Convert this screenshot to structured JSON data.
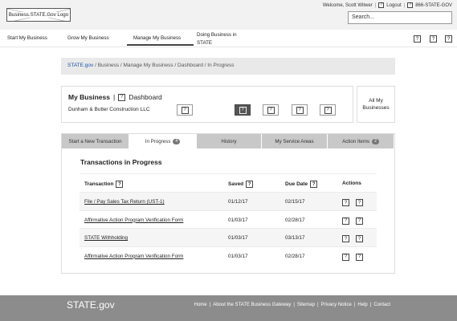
{
  "header": {
    "logo_text": "Business.STATE.Gov Logo",
    "welcome": "Welcome, Scott Witwer",
    "logout": "Logout",
    "phone": "866-STATE-GOV",
    "search_placeholder": "Search..."
  },
  "nav": {
    "items": [
      "Start My Business",
      "Grow My Business",
      "Manage My Business"
    ],
    "doing_line1": "Doing Business in",
    "doing_line2": "STATE"
  },
  "breadcrumb": {
    "home": "STATE.gov",
    "path": "/   Business  /  Manage My Business  /  Dashboard  /  In Progress"
  },
  "dashboard": {
    "title": "My Business",
    "separator": "|",
    "subtitle": "Dashboard",
    "company": "Dunham & Butler Construction LLC",
    "all_businesses_line1": "All My",
    "all_businesses_line2": "Businesses"
  },
  "tabs": [
    {
      "label": "Start a New Transaction",
      "badge": ""
    },
    {
      "label": "In Progress",
      "badge": "4"
    },
    {
      "label": "History",
      "badge": ""
    },
    {
      "label": "My Service Areas",
      "badge": ""
    },
    {
      "label": "Action Items",
      "badge": "2"
    }
  ],
  "section_title": "Transactions in Progress",
  "columns": {
    "transaction": "Transaction",
    "saved": "Saved",
    "due": "Due Date",
    "actions": "Actions"
  },
  "rows": [
    {
      "name": "File / Pay Sales Tax Return (UST-1)",
      "saved": "01/12/17",
      "due": "02/15/17"
    },
    {
      "name": "Affirmative Action Program Verification Form",
      "saved": "01/03/17",
      "due": "02/28/17"
    },
    {
      "name": "STATE Withholding",
      "saved": "01/03/17",
      "due": "03/13/17"
    },
    {
      "name": "Affirmative Action Program Verification Form",
      "saved": "01/03/17",
      "due": "02/28/17"
    }
  ],
  "help_glyph": "?",
  "footer": {
    "logo": "STATE.gov",
    "links": [
      "Home",
      "About the STATE Business Gateway",
      "Sitemap",
      "Privacy Notice",
      "Help",
      "Contact"
    ],
    "separator": "|"
  }
}
